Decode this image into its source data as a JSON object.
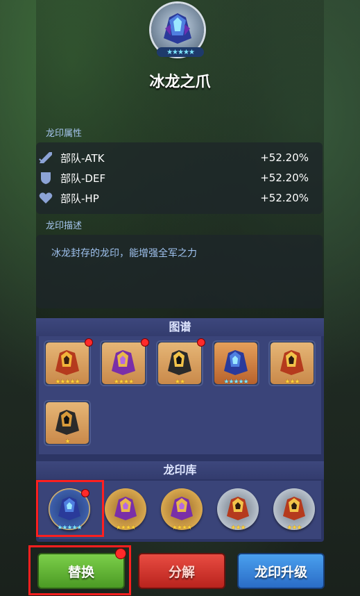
{
  "item": {
    "name": "冰龙之爪",
    "stars": "★★★★★"
  },
  "attributes": {
    "label": "龙印属性",
    "rows": [
      {
        "name": "部队-ATK",
        "value": "+52.20%",
        "icon": "sword-icon"
      },
      {
        "name": "部队-DEF",
        "value": "+52.20%",
        "icon": "shield-icon"
      },
      {
        "name": "部队-HP",
        "value": "+52.20%",
        "icon": "heart-icon"
      }
    ]
  },
  "description": {
    "label": "龙印描述",
    "text": "冰龙封存的龙印，能增强全军之力"
  },
  "collection": {
    "header": "图谱",
    "slots": [
      {
        "stars": "★★★★★",
        "star_color": "gold",
        "has_dot": true
      },
      {
        "stars": "★★★★",
        "star_color": "gold",
        "has_dot": true
      },
      {
        "stars": "★★",
        "star_color": "gold",
        "has_dot": true
      },
      {
        "stars": "★★★★★",
        "star_color": "blue",
        "has_dot": false
      },
      {
        "stars": "★★★",
        "star_color": "gold",
        "has_dot": false
      },
      {
        "stars": "★",
        "star_color": "gold",
        "has_dot": false
      }
    ]
  },
  "library": {
    "header": "龙印库",
    "coins": [
      {
        "stars": "★★★★★",
        "rim": "blue",
        "selected": true
      },
      {
        "stars": "★★★★",
        "rim": "gold",
        "selected": false
      },
      {
        "stars": "★★★★",
        "rim": "gold",
        "selected": false
      },
      {
        "stars": "★★★",
        "rim": "silver",
        "selected": false
      },
      {
        "stars": "★★★",
        "rim": "silver",
        "selected": false
      }
    ]
  },
  "buttons": {
    "replace": "替换",
    "decompose": "分解",
    "upgrade": "龙印升级"
  },
  "colors": {
    "accent_red": "#ff1f1f",
    "label_blue": "#a6c6f0",
    "panel_navy": "#2c3564"
  }
}
